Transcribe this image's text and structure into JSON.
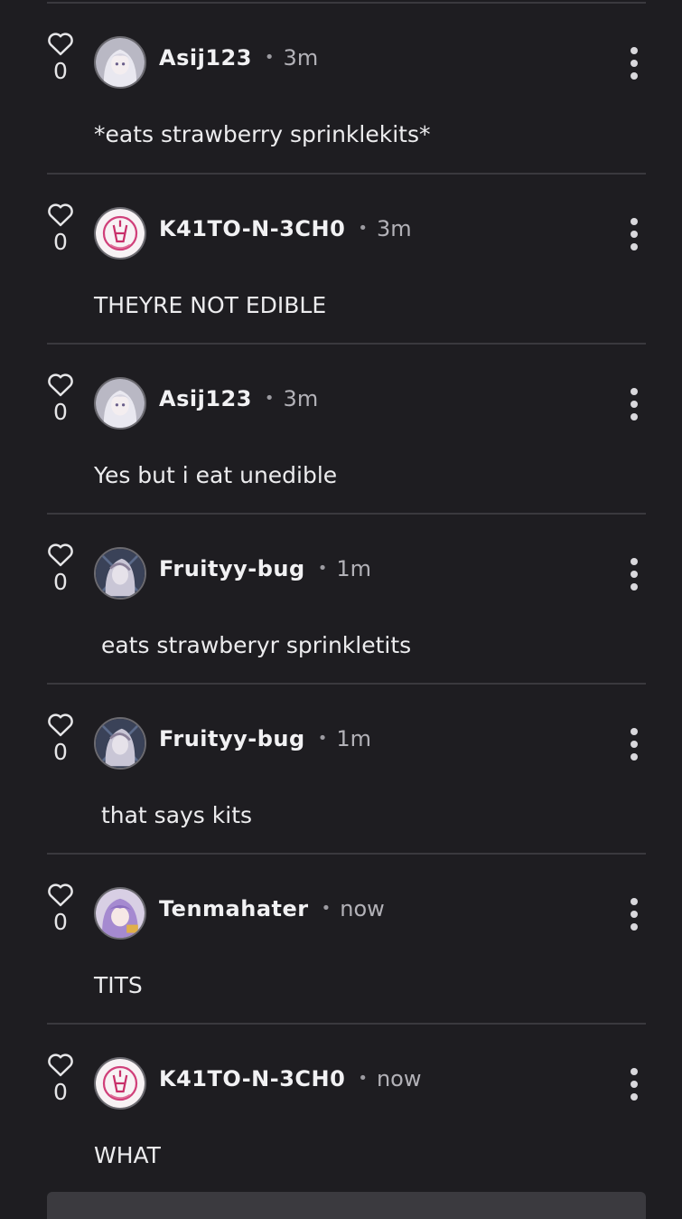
{
  "colors": {
    "background": "#1e1d21",
    "divider": "#3a393e",
    "username": "#f1f1f3",
    "muted": "#b3b2b8"
  },
  "comments": [
    {
      "likes": "0",
      "username": "Asij123",
      "time": "3m",
      "text": "*eats strawberry sprinklekits*",
      "avatar": "white-hair-avatar"
    },
    {
      "likes": "0",
      "username": "K41TO-N-3CH0",
      "time": "3m",
      "text": "THEYRE NOT EDIBLE",
      "avatar": "pink-sketch-avatar"
    },
    {
      "likes": "0",
      "username": "Asij123",
      "time": "3m",
      "text": "Yes but i eat unedible",
      "avatar": "white-hair-avatar"
    },
    {
      "likes": "0",
      "username": "Fruityy-bug",
      "time": "1m",
      "text": " eats strawberyr sprinkletits",
      "avatar": "dark-anime-avatar"
    },
    {
      "likes": "0",
      "username": "Fruityy-bug",
      "time": "1m",
      "text": " that says kits",
      "avatar": "dark-anime-avatar"
    },
    {
      "likes": "0",
      "username": "Tenmahater",
      "time": "now",
      "text": "TITS",
      "avatar": "purple-hair-avatar"
    },
    {
      "likes": "0",
      "username": "K41TO-N-3CH0",
      "time": "now",
      "text": "WHAT",
      "avatar": "pink-sketch-avatar"
    }
  ],
  "dot_separator": "•"
}
